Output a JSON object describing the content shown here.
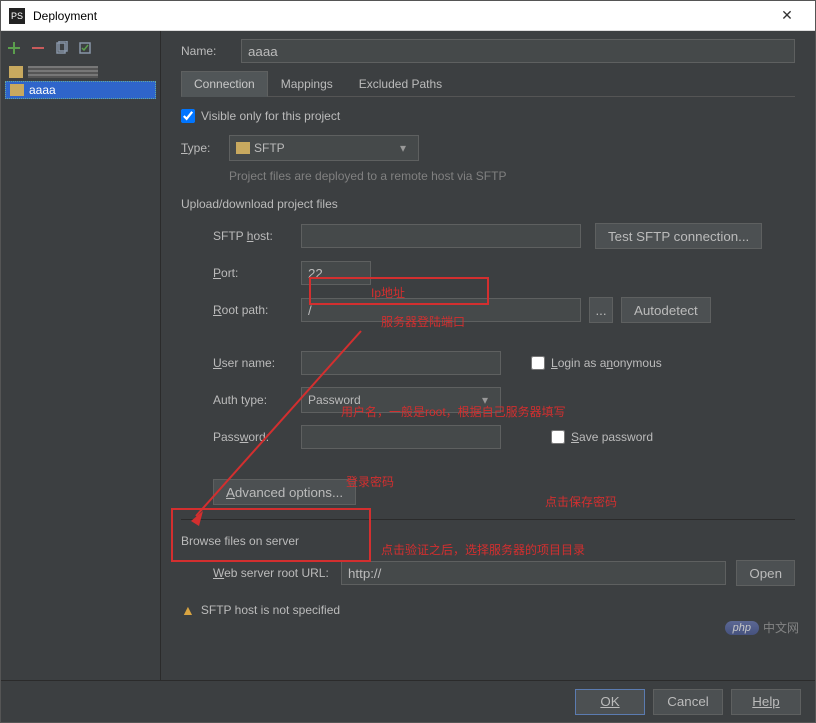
{
  "window": {
    "title": "Deployment"
  },
  "sidebar": {
    "items": [
      {
        "label": ""
      },
      {
        "label": "aaaa"
      }
    ]
  },
  "form": {
    "name_label": "Name:",
    "name_value": "aaaa"
  },
  "tabs": {
    "connection": "Connection",
    "mappings": "Mappings",
    "excluded": "Excluded Paths"
  },
  "visible_only": "Visible only for this project",
  "type": {
    "label": "Type:",
    "value": "SFTP",
    "hint": "Project files are deployed to a remote host via SFTP"
  },
  "section_upload": "Upload/download project files",
  "fields": {
    "sftp_host_label": "SFTP host:",
    "sftp_host_value": "",
    "test_btn": "Test SFTP connection...",
    "port_label": "Port:",
    "port_value": "22",
    "root_path_label": "Root path:",
    "root_path_value": "/",
    "root_browse": "...",
    "autodetect": "Autodetect",
    "user_name_label": "User name:",
    "user_name_value": "",
    "login_anon": "Login as anonymous",
    "auth_type_label": "Auth type:",
    "auth_type_value": "Password",
    "password_label": "Password:",
    "password_value": "",
    "save_password": "Save password",
    "advanced": "Advanced options..."
  },
  "section_browse": "Browse files on server",
  "web": {
    "label": "Web server root URL:",
    "value": "http://",
    "open": "Open"
  },
  "validation": "SFTP host is not specified",
  "footer": {
    "ok": "OK",
    "cancel": "Cancel",
    "help": "Help"
  },
  "annotations": {
    "ip": "Ip地址",
    "port": "服务器登陆端口",
    "user": "用户名，一般是root，根据自己服务器填写",
    "pwd": "登录密码",
    "save": "点击保存密码",
    "adv": "点击验证之后，选择服务器的项目目录"
  },
  "watermark": {
    "badge": "php",
    "text": "中文网"
  }
}
